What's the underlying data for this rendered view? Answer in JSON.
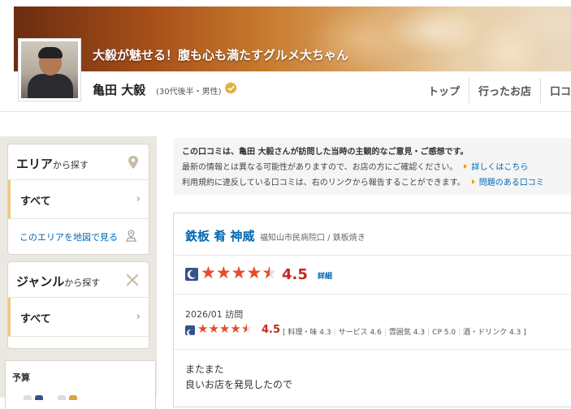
{
  "header": {
    "tagline": "大毅が魅せる！腹も心も満たすグルメ大ちゃん",
    "user_name": "亀田 大毅",
    "user_meta": "(30代後半・男性)",
    "nav": [
      "トップ",
      "行ったお店",
      "口コ"
    ]
  },
  "sidebar": {
    "area": {
      "title_strong": "エリア",
      "title_small": "から探す",
      "selected": "すべて",
      "map_link": "このエリアを地図で見る"
    },
    "genre": {
      "title_strong": "ジャンル",
      "title_small": "から探す",
      "selected": "すべて"
    },
    "budget_label": "予算"
  },
  "notice": {
    "line1": "この口コミは、亀田 大毅さんが訪問した当時の主観的なご意見・ご感想です。",
    "line2": "最新の情報とは異なる可能性がありますので、お店の方にご確認ください。",
    "line2_link": "詳しくはこちら",
    "line3": "利用規約に違反している口コミは、右のリンクから報告することができます。",
    "line3_link": "問題のある口コミ"
  },
  "review": {
    "restaurant_name": "鉄板 肴 神威",
    "restaurant_meta": "福知山市民病院口 / 鉄板焼き",
    "overall_score": "4.5",
    "overall_rating": 4.5,
    "detail_link": "詳細",
    "visit": "2026/01 訪問",
    "visit_score": "4.5",
    "visit_rating": 4.5,
    "subscores": [
      {
        "label": "料理・味",
        "value": "4.3"
      },
      {
        "label": "サービス",
        "value": "4.6"
      },
      {
        "label": "雰囲気",
        "value": "4.3"
      },
      {
        "label": "CP",
        "value": "5.0"
      },
      {
        "label": "酒・ドリンク",
        "value": "4.3"
      }
    ],
    "body_lines": [
      "またまた",
      "良いお店を発見したので"
    ]
  },
  "colors": {
    "link": "#0066b3",
    "score": "#c4281c",
    "star": "#e84c2c",
    "accent": "#f3c77a"
  }
}
